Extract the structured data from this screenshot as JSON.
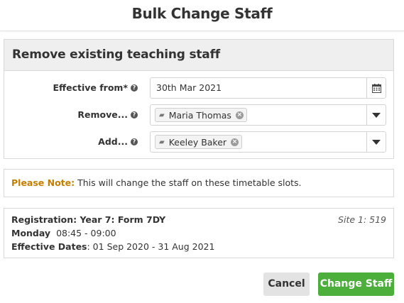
{
  "modal": {
    "title": "Bulk Change Staff"
  },
  "section": {
    "title": "Remove existing teaching staff"
  },
  "form": {
    "effective_from": {
      "label": "Effective from*",
      "value": "30th Mar 2021"
    },
    "remove": {
      "label": "Remove...",
      "tag": "Maria Thomas"
    },
    "add": {
      "label": "Add...",
      "tag": "Keeley Baker"
    }
  },
  "note": {
    "label": "Please Note:",
    "text": "This will change the staff on these timetable slots."
  },
  "slot": {
    "registration_label": "Registration: Year 7: Form 7DY",
    "site": "Site 1: 519",
    "day": "Monday",
    "time": "08:45 - 09:00",
    "dates_label": "Effective Dates",
    "dates_value": ": 01 Sep 2020 - 31 Aug 2021"
  },
  "buttons": {
    "cancel": "Cancel",
    "change": "Change Staff"
  },
  "colors": {
    "accent_green": "#4caf3c",
    "note_orange": "#c47f00"
  },
  "icons": {
    "help": "question-circle-icon",
    "calendar": "calendar-icon",
    "tag": "graduation-cap-icon",
    "remove": "x-circle-icon",
    "dropdown": "caret-down-icon"
  }
}
